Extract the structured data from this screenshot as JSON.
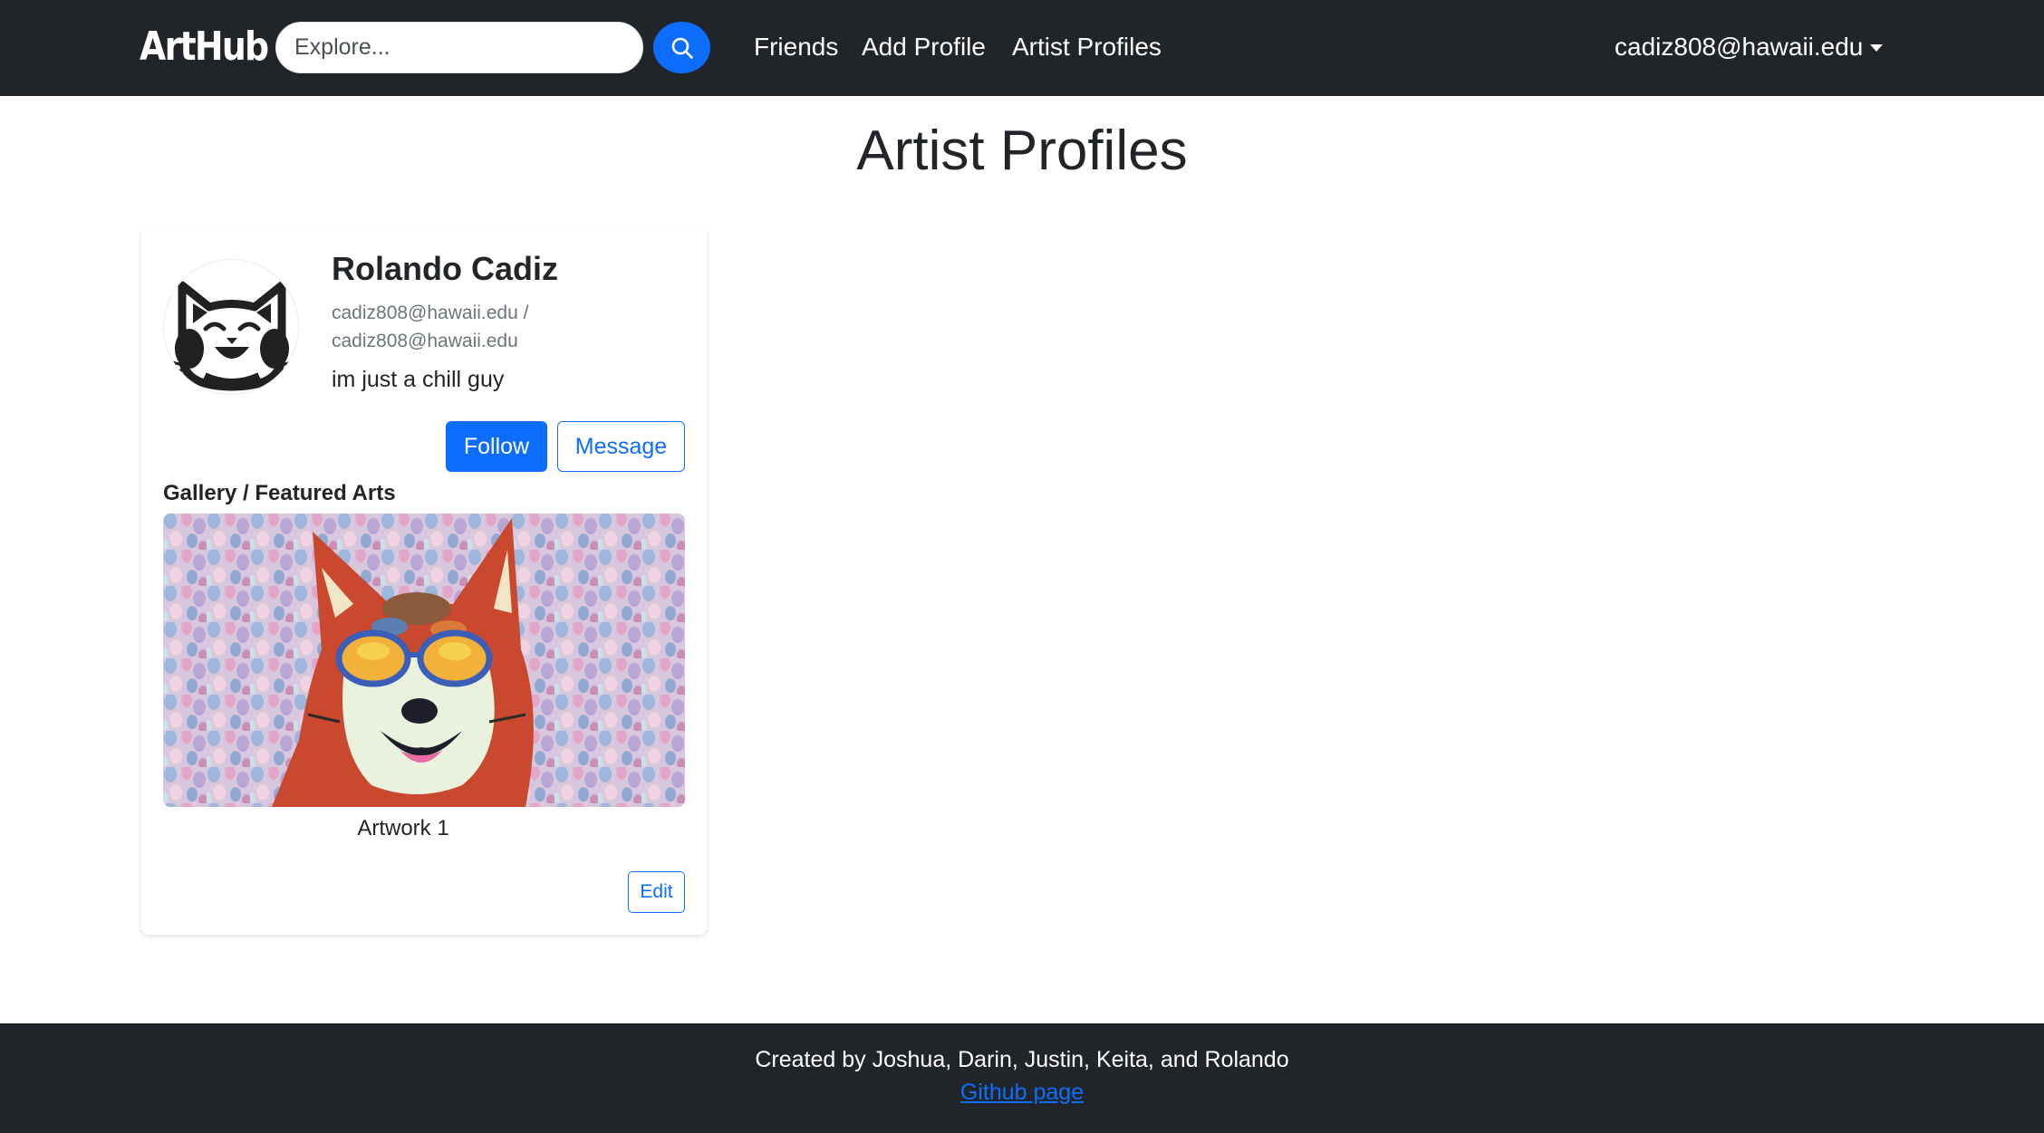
{
  "navbar": {
    "brand": "ArtHub",
    "search_placeholder": "Explore...",
    "search_icon": "search-icon",
    "links": [
      "Friends",
      "Add Profile",
      "Artist Profiles"
    ],
    "user_email": "cadiz808@hawaii.edu"
  },
  "page": {
    "title": "Artist Profiles"
  },
  "profile": {
    "name": "Rolando Cadiz",
    "email_line1": "cadiz808@hawaii.edu /",
    "email_line2": "cadiz808@hawaii.edu",
    "bio": "im just a chill guy",
    "follow_label": "Follow",
    "message_label": "Message",
    "gallery_heading": "Gallery / Featured Arts",
    "artwork_caption": "Artwork 1",
    "edit_label": "Edit",
    "avatar_icon": "cat-face-icon"
  },
  "footer": {
    "credit": "Created by Joshua, Darin, Justin, Keita, and Rolando",
    "link_label": "Github page"
  },
  "colors": {
    "navbar_bg": "#212529",
    "primary": "#0d6efd",
    "text": "#212529",
    "muted": "#6c757d"
  }
}
